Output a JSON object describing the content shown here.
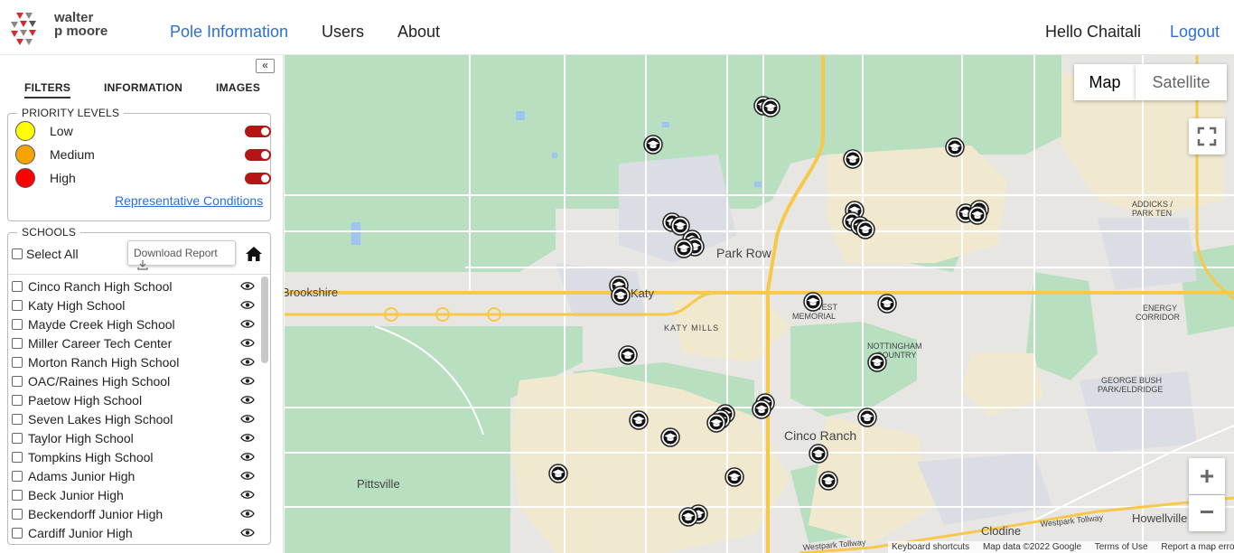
{
  "brand": {
    "name_line1": "walter",
    "name_line2": "p moore"
  },
  "nav": {
    "pole_information": "Pole Information",
    "users": "Users",
    "about": "About",
    "greeting": "Hello Chaitali",
    "logout": "Logout"
  },
  "sidebar": {
    "collapse_glyph": "«",
    "tabs": [
      "FILTERS",
      "INFORMATION",
      "IMAGES"
    ],
    "priority": {
      "legend": "PRIORITY LEVELS",
      "levels": [
        {
          "label": "Low",
          "color": "#ffff00",
          "enabled": true
        },
        {
          "label": "Medium",
          "color": "#f5a300",
          "enabled": true
        },
        {
          "label": "High",
          "color": "#ff0000",
          "enabled": true
        }
      ],
      "representative_link": "Representative Conditions"
    },
    "schools": {
      "legend": "SCHOOLS",
      "select_all": "Select All",
      "download": "Download Report",
      "items": [
        "Cinco Ranch High School",
        "Katy High School",
        "Mayde Creek High School",
        "Miller Career Tech Center",
        "Morton Ranch High School",
        "OAC/Raines High School",
        "Paetow High School",
        "Seven Lakes High School",
        "Taylor High School",
        "Tompkins High School",
        "Adams Junior High",
        "Beck Junior High",
        "Beckendorff Junior High",
        "Cardiff Junior High"
      ]
    }
  },
  "map": {
    "type_map": "Map",
    "type_satellite": "Satellite",
    "zoom_in": "+",
    "zoom_out": "−",
    "labels": {
      "park_row": "Park Row",
      "brookshire": "Brookshire",
      "katy": "Katy",
      "katy_mills": "KATY MILLS",
      "west_memorial_1": "WEST",
      "west_memorial_2": "MEMORIAL",
      "nottingham_1": "NOTTINGHAM",
      "nottingham_2": "COUNTRY",
      "addicks_1": "ADDICKS /",
      "addicks_2": "PARK TEN",
      "energy_1": "ENERGY",
      "energy_2": "CORRIDOR",
      "george_bush_1": "GEORGE BUSH",
      "george_bush_2": "PARK/ELDRIDGE",
      "cinco_ranch": "Cinco Ranch",
      "pittsville": "Pittsville",
      "clodine": "Clodine",
      "howellville": "Howellville",
      "westpark_tollway_1": "Westpark Tollway",
      "westpark_tollway_2": "Westpark Tollway"
    },
    "attribution": {
      "keyboard": "Keyboard shortcuts",
      "data": "Map data ©2022 Google",
      "terms": "Terms of Use",
      "report": "Report a map error"
    }
  }
}
